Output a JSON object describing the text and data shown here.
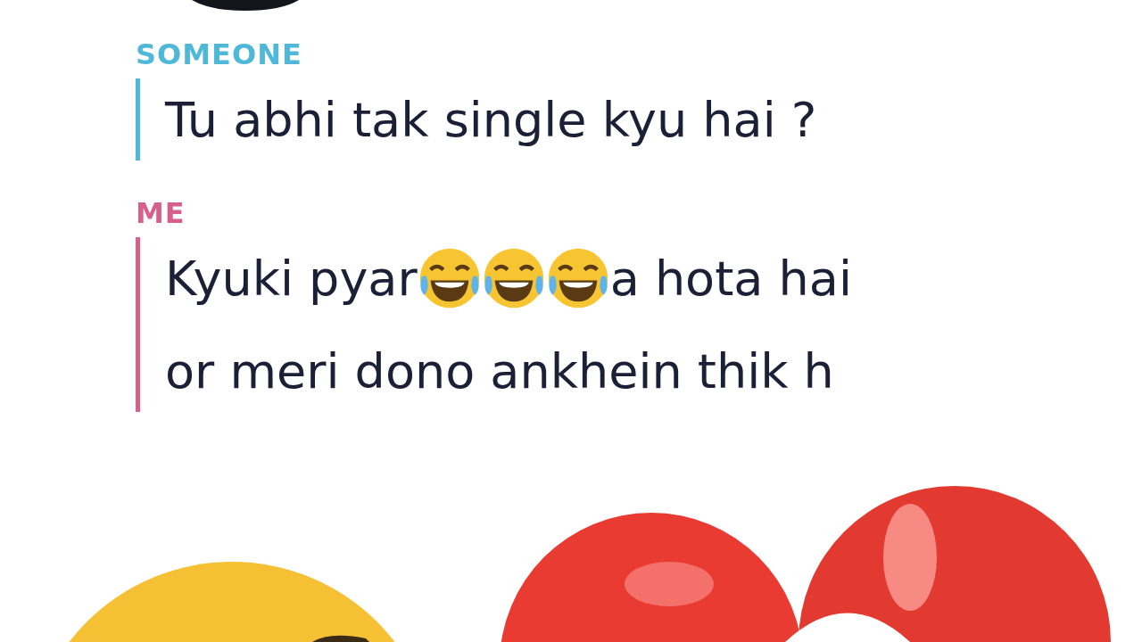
{
  "messages": [
    {
      "sender": "SOMEONE",
      "color": "#4fb8d9",
      "lines": [
        [
          {
            "kind": "text",
            "text": "Tu abhi tak single kyu hai ?"
          }
        ]
      ]
    },
    {
      "sender": "ME",
      "color": "#d6608a",
      "lines": [
        [
          {
            "kind": "text",
            "text": "Kyuki pyar"
          },
          {
            "kind": "emoji"
          },
          {
            "kind": "emoji"
          },
          {
            "kind": "emoji"
          },
          {
            "kind": "text",
            "text": "a hota hai"
          }
        ],
        [
          {
            "kind": "text",
            "text": "or meri dono ankhein thik h"
          }
        ]
      ]
    }
  ]
}
